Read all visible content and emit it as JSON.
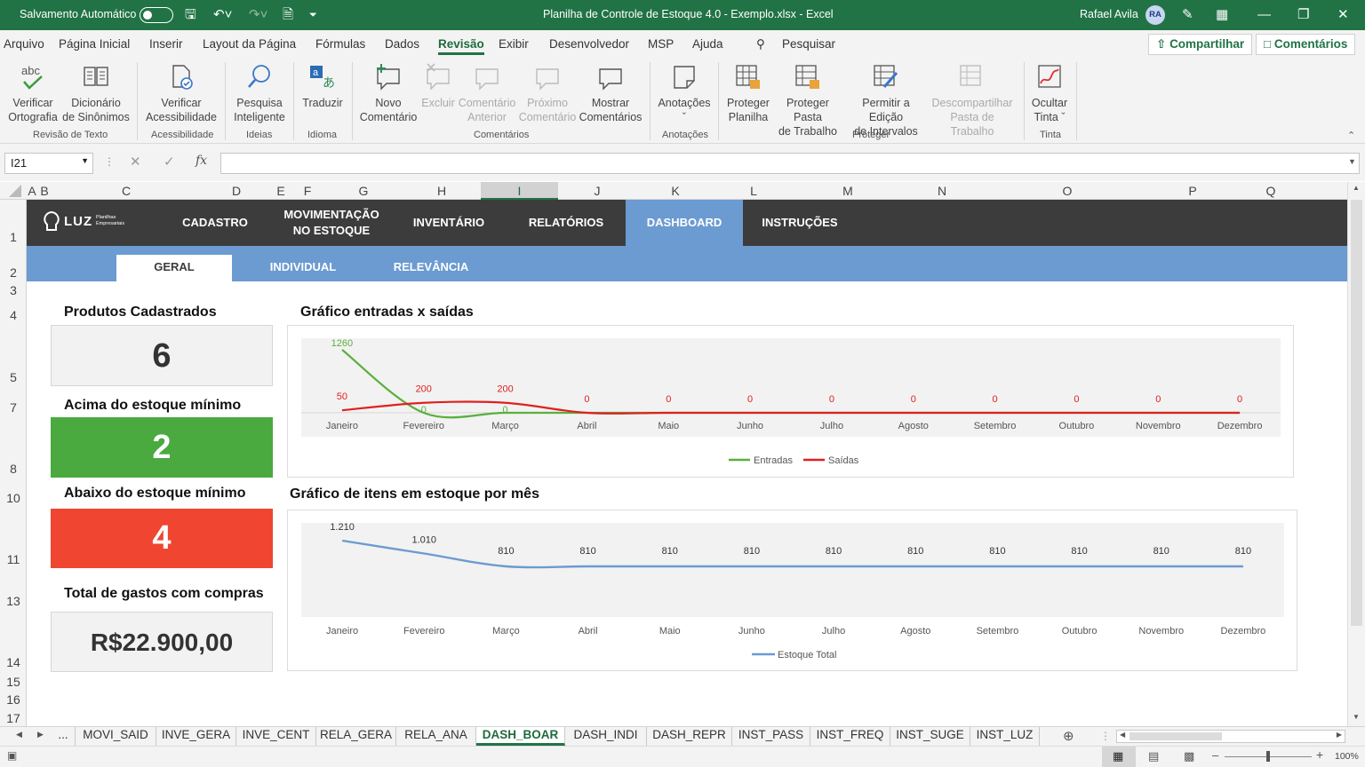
{
  "titlebar": {
    "autosave": "Salvamento Automático",
    "title": "Planilha de Controle de Estoque 4.0 - Exemplo.xlsx - Excel",
    "user": "Rafael Avila",
    "initials": "RA"
  },
  "menu": [
    "Arquivo",
    "Página Inicial",
    "Inserir",
    "Layout da Página",
    "Fórmulas",
    "Dados",
    "Revisão",
    "Exibir",
    "Desenvolvedor",
    "MSP",
    "Ajuda"
  ],
  "search": "Pesquisar",
  "share": "Compartilhar",
  "comments": "Comentários",
  "ribbon": {
    "spell1": "Verificar",
    "spell2": "Ortografia",
    "thes1": "Dicionário",
    "thes2": "de Sinônimos",
    "acc1": "Verificar",
    "acc2": "Acessibilidade",
    "smart1": "Pesquisa",
    "smart2": "Inteligente",
    "translate": "Traduzir",
    "new1": "Novo",
    "new2": "Comentário",
    "del": "Excluir",
    "prev1": "Comentário",
    "prev2": "Anterior",
    "next1": "Próximo",
    "next2": "Comentário",
    "show1": "Mostrar",
    "show2": "Comentários",
    "notes": "Anotações",
    "ps1": "Proteger",
    "ps2": "Planilha",
    "pw1": "Proteger Pasta",
    "pw2": "de Trabalho",
    "ar1": "Permitir a Edição",
    "ar2": "de Intervalos",
    "us1": "Descompartilhar",
    "us2": "Pasta de Trabalho",
    "ink1": "Ocultar",
    "ink2": "Tinta",
    "g1": "Revisão de Texto",
    "g2": "Acessibilidade",
    "g3": "Ideias",
    "g4": "Idioma",
    "g5": "Comentários",
    "g6": "Anotações",
    "g7": "Proteger",
    "g8": "Tinta"
  },
  "namebox": "I21",
  "columns": [
    "A",
    "B",
    "C",
    "D",
    "E",
    "F",
    "G",
    "H",
    "I",
    "J",
    "K",
    "L",
    "M",
    "N",
    "O",
    "P",
    "Q"
  ],
  "rows": [
    "1",
    "2",
    "3",
    "4",
    "5",
    "7",
    "8",
    "10",
    "11",
    "13",
    "14",
    "15",
    "16",
    "17"
  ],
  "logo": {
    "brand": "LUZ",
    "sub1": "Planilhas",
    "sub2": "Empresariais"
  },
  "nav": {
    "cadastro": "CADASTRO",
    "mov1": "MOVIMENTAÇÃO",
    "mov2": "NO ESTOQUE",
    "inventario": "INVENTÁRIO",
    "relatorios": "RELATÓRIOS",
    "dashboard": "DASHBOARD",
    "instrucoes": "INSTRUÇÕES"
  },
  "subnav": {
    "geral": "GERAL",
    "individual": "INDIVIDUAL",
    "relevancia": "RELEVÂNCIA"
  },
  "kpis": {
    "products_label": "Produtos Cadastrados",
    "products_value": "6",
    "above_label": "Acima do estoque mínimo",
    "above_value": "2",
    "below_label": "Abaixo do estoque mínimo",
    "below_value": "4",
    "spend_label": "Total de gastos com compras",
    "spend_value": "R$22.900,00"
  },
  "colors": {
    "green": "#4aaa3f",
    "red": "#f04530",
    "blue": "#6b9bd1",
    "entradas": "#5aaf3c",
    "saidas": "#e02020",
    "estoque": "#6b9bd1"
  },
  "chart_data": [
    {
      "type": "line",
      "title": "Gráfico entradas x saídas",
      "categories": [
        "Janeiro",
        "Fevereiro",
        "Março",
        "Abril",
        "Maio",
        "Junho",
        "Julho",
        "Agosto",
        "Setembro",
        "Outubro",
        "Novembro",
        "Dezembro"
      ],
      "series": [
        {
          "name": "Entradas",
          "values": [
            1260,
            0,
            0,
            null,
            null,
            null,
            null,
            null,
            null,
            null,
            null,
            null
          ]
        },
        {
          "name": "Saídas",
          "values": [
            50,
            200,
            200,
            0,
            0,
            0,
            0,
            0,
            0,
            0,
            0,
            0
          ]
        }
      ],
      "legend": "bottom"
    },
    {
      "type": "line",
      "title": "Gráfico de itens em estoque por mês",
      "categories": [
        "Janeiro",
        "Fevereiro",
        "Março",
        "Abril",
        "Maio",
        "Junho",
        "Julho",
        "Agosto",
        "Setembro",
        "Outubro",
        "Novembro",
        "Dezembro"
      ],
      "series": [
        {
          "name": "Estoque Total",
          "values": [
            1210,
            1010,
            810,
            810,
            810,
            810,
            810,
            810,
            810,
            810,
            810,
            810
          ]
        }
      ],
      "labels": [
        "1.210",
        "1.010",
        "810",
        "810",
        "810",
        "810",
        "810",
        "810",
        "810",
        "810",
        "810",
        "810"
      ],
      "legend": "bottom"
    }
  ],
  "tabs": [
    "...",
    "MOVI_SAID",
    "INVE_GERA",
    "INVE_CENT",
    "RELA_GERA",
    "RELA_ANA",
    "DASH_BOAR",
    "DASH_INDI",
    "DASH_REPR",
    "INST_PASS",
    "INST_FREQ",
    "INST_SUGE",
    "INST_LUZ"
  ],
  "zoom": "100%"
}
